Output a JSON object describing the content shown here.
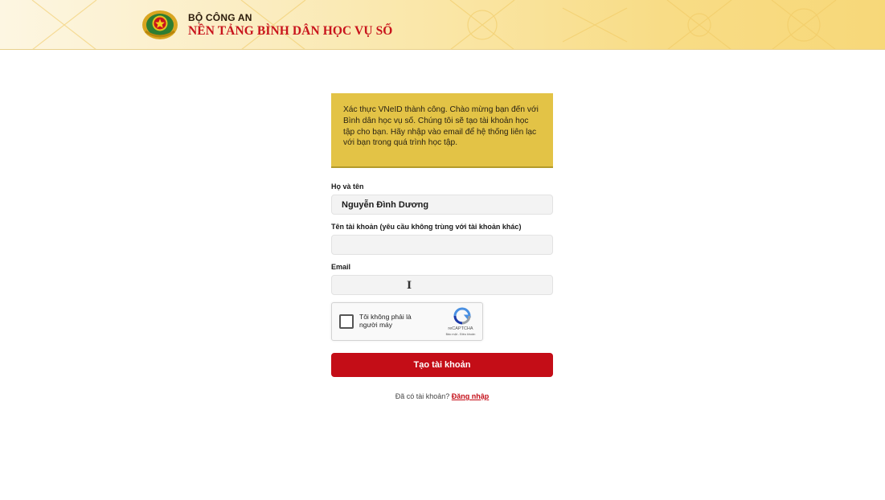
{
  "header": {
    "brand_top": "BỘ CÔNG AN",
    "brand_main": "NỀN TẢNG BÌNH DÂN HỌC VỤ SỐ",
    "logo_icon": "police-emblem-icon"
  },
  "notice": {
    "text": "Xác thực VNeID thành công. Chào mừng bạn đến với Bình dân học vụ số. Chúng tôi sẽ tạo tài khoản học tập cho bạn. Hãy nhập vào email để hệ thống liên lạc với bạn trong quá trình học tập."
  },
  "form": {
    "fullname_label": "Họ và tên",
    "fullname_value": "Nguyễn Đình Dương",
    "username_label": "Tên tài khoản (yêu cầu không trùng với tài khoản khác)",
    "username_value": "",
    "email_label": "Email",
    "email_value": ""
  },
  "recaptcha": {
    "label": "Tôi không phải là người máy",
    "brand": "reCAPTCHA",
    "links": "Bảo mật - Điều khoản"
  },
  "actions": {
    "submit_label": "Tạo tài khoản",
    "have_account": "Đã có tài khoản?",
    "login_label": "Đăng nhập"
  },
  "colors": {
    "primary": "#c40d17",
    "notice_bg": "#e3c346",
    "header_gold": "#f7d879"
  }
}
